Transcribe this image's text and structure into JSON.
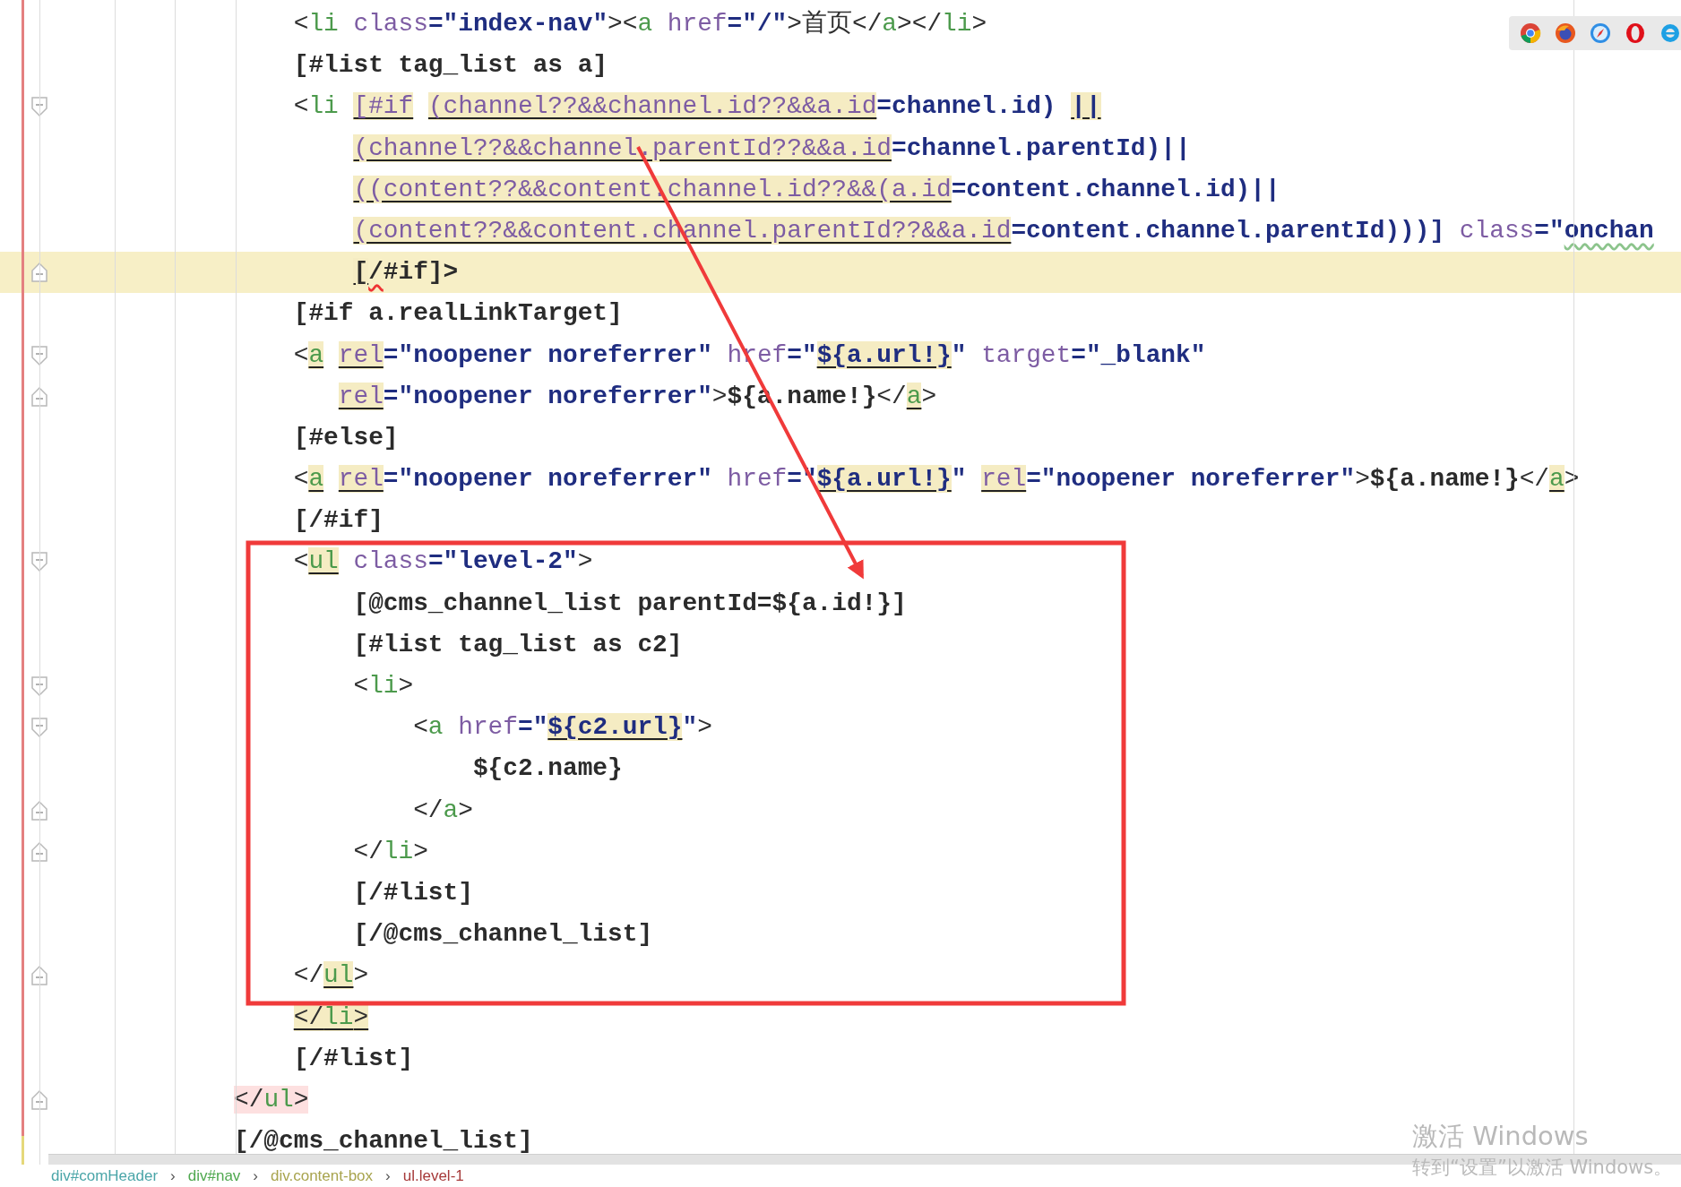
{
  "editor": {
    "lines": [
      {
        "fold_start": false,
        "fold_end": false,
        "current": false,
        "tokens": [
          {
            "kind": "punct",
            "text": "    <"
          },
          {
            "kind": "tag",
            "text": "li "
          },
          {
            "kind": "attr",
            "text": "class"
          },
          {
            "kind": "op",
            "text": "=\"index-nav\""
          },
          {
            "kind": "punct",
            "text": "><"
          },
          {
            "kind": "tag",
            "text": "a "
          },
          {
            "kind": "attr",
            "text": "href"
          },
          {
            "kind": "op",
            "text": "=\"/\""
          },
          {
            "kind": "punct",
            "text": ">"
          },
          {
            "kind": "plain",
            "text": "首页"
          },
          {
            "kind": "punct",
            "text": "</"
          },
          {
            "kind": "tag",
            "text": "a"
          },
          {
            "kind": "punct",
            "text": "></"
          },
          {
            "kind": "tag",
            "text": "li"
          },
          {
            "kind": "punct",
            "text": ">"
          }
        ]
      },
      {
        "fold_start": false,
        "fold_end": false,
        "current": false,
        "tokens": [
          {
            "kind": "directive",
            "text": "    [#list tag_list as a]"
          }
        ]
      },
      {
        "fold_start": true,
        "fold_end": false,
        "current": false,
        "tokens": [
          {
            "kind": "punct",
            "text": "    <"
          },
          {
            "kind": "tag",
            "text": "li "
          },
          {
            "kind": "expr_match",
            "text": "[#if "
          },
          {
            "kind": "expr_match",
            "text": "(channel??&&channel.id??&&a.id"
          },
          {
            "kind": "op",
            "text": "=channel.id) "
          },
          {
            "kind": "op_match",
            "text": "||"
          }
        ]
      },
      {
        "fold_start": false,
        "fold_end": false,
        "current": false,
        "tokens": [
          {
            "kind": "expr_match",
            "text": "        (channel??&&channel.parentId??&&a.id"
          },
          {
            "kind": "op",
            "text": "=channel.parentId)||"
          }
        ]
      },
      {
        "fold_start": false,
        "fold_end": false,
        "current": false,
        "tokens": [
          {
            "kind": "expr_match",
            "text": "        ((content??&&content.channel.id??&&(a.id"
          },
          {
            "kind": "op",
            "text": "=content.channel.id)||"
          }
        ]
      },
      {
        "fold_start": false,
        "fold_end": false,
        "current": false,
        "tokens": [
          {
            "kind": "expr_match",
            "text": "        (content??&&content.channel.parentId??&&a.id"
          },
          {
            "kind": "op",
            "text": "=content.channel.parentId)))] "
          },
          {
            "kind": "attr",
            "text": "class"
          },
          {
            "kind": "op",
            "text": "=\""
          },
          {
            "kind": "op_wave",
            "text": "onchan"
          }
        ]
      },
      {
        "fold_start": false,
        "fold_end": true,
        "current": true,
        "tokens": [
          {
            "kind": "directive_match",
            "text": "        ["
          },
          {
            "kind": "directive_error",
            "text": "/"
          },
          {
            "kind": "directive",
            "text": "#if]>"
          }
        ]
      },
      {
        "fold_start": false,
        "fold_end": false,
        "current": false,
        "tokens": [
          {
            "kind": "directive",
            "text": "    [#if a.realLinkTarget]"
          }
        ]
      },
      {
        "fold_start": true,
        "fold_end": false,
        "current": false,
        "tokens": [
          {
            "kind": "punct",
            "text": "    <"
          },
          {
            "kind": "tag_match",
            "text": "a "
          },
          {
            "kind": "attr_match",
            "text": "rel"
          },
          {
            "kind": "op",
            "text": "=\"noopener noreferrer\" "
          },
          {
            "kind": "attr",
            "text": "href"
          },
          {
            "kind": "op",
            "text": "=\""
          },
          {
            "kind": "op_match",
            "text": "${a.url!}"
          },
          {
            "kind": "op",
            "text": "\" "
          },
          {
            "kind": "attr",
            "text": "target"
          },
          {
            "kind": "op",
            "text": "=\"_blank\""
          }
        ]
      },
      {
        "fold_start": false,
        "fold_end": true,
        "current": false,
        "tokens": [
          {
            "kind": "attr_match",
            "text": "       rel"
          },
          {
            "kind": "op",
            "text": "=\"noopener noreferrer\""
          },
          {
            "kind": "punct",
            "text": ">"
          },
          {
            "kind": "directive",
            "text": "${a.name!}"
          },
          {
            "kind": "punct",
            "text": "</"
          },
          {
            "kind": "tag_match",
            "text": "a"
          },
          {
            "kind": "punct",
            "text": ">"
          }
        ]
      },
      {
        "fold_start": false,
        "fold_end": false,
        "current": false,
        "tokens": [
          {
            "kind": "directive",
            "text": "    [#else]"
          }
        ]
      },
      {
        "fold_start": false,
        "fold_end": false,
        "current": false,
        "tokens": [
          {
            "kind": "punct",
            "text": "    <"
          },
          {
            "kind": "tag_match",
            "text": "a "
          },
          {
            "kind": "attr_match",
            "text": "rel"
          },
          {
            "kind": "op",
            "text": "=\"noopener noreferrer\" "
          },
          {
            "kind": "attr",
            "text": "href"
          },
          {
            "kind": "op",
            "text": "=\""
          },
          {
            "kind": "op_match",
            "text": "${a.url!}"
          },
          {
            "kind": "op",
            "text": "\" "
          },
          {
            "kind": "attr_match",
            "text": "rel"
          },
          {
            "kind": "op",
            "text": "=\"noopener noreferrer\""
          },
          {
            "kind": "punct",
            "text": ">"
          },
          {
            "kind": "directive",
            "text": "${a.name!}"
          },
          {
            "kind": "punct",
            "text": "</"
          },
          {
            "kind": "tag_match",
            "text": "a"
          },
          {
            "kind": "punct",
            "text": ">"
          }
        ]
      },
      {
        "fold_start": false,
        "fold_end": false,
        "current": false,
        "tokens": [
          {
            "kind": "directive",
            "text": "    [/#if]"
          }
        ]
      },
      {
        "fold_start": true,
        "fold_end": false,
        "current": false,
        "tokens": [
          {
            "kind": "punct",
            "text": "    <"
          },
          {
            "kind": "tag_match",
            "text": "ul "
          },
          {
            "kind": "attr",
            "text": "class"
          },
          {
            "kind": "op",
            "text": "=\"level-2\""
          },
          {
            "kind": "punct",
            "text": ">"
          }
        ]
      },
      {
        "fold_start": false,
        "fold_end": false,
        "current": false,
        "tokens": [
          {
            "kind": "directive",
            "text": "        [@cms_channel_list parentId=${a.id!}]"
          }
        ]
      },
      {
        "fold_start": false,
        "fold_end": false,
        "current": false,
        "tokens": [
          {
            "kind": "directive",
            "text": "        [#list tag_list as c2]"
          }
        ]
      },
      {
        "fold_start": true,
        "fold_end": false,
        "current": false,
        "tokens": [
          {
            "kind": "punct",
            "text": "        <"
          },
          {
            "kind": "tag",
            "text": "li"
          },
          {
            "kind": "punct",
            "text": ">"
          }
        ]
      },
      {
        "fold_start": true,
        "fold_end": false,
        "current": false,
        "tokens": [
          {
            "kind": "punct",
            "text": "            <"
          },
          {
            "kind": "tag",
            "text": "a "
          },
          {
            "kind": "attr",
            "text": "href"
          },
          {
            "kind": "op",
            "text": "=\""
          },
          {
            "kind": "op_match",
            "text": "${c2.url}"
          },
          {
            "kind": "op",
            "text": "\""
          },
          {
            "kind": "punct",
            "text": ">"
          }
        ]
      },
      {
        "fold_start": false,
        "fold_end": false,
        "current": false,
        "tokens": [
          {
            "kind": "directive",
            "text": "                ${c2.name}"
          }
        ]
      },
      {
        "fold_start": false,
        "fold_end": true,
        "current": false,
        "tokens": [
          {
            "kind": "punct",
            "text": "            </"
          },
          {
            "kind": "tag",
            "text": "a"
          },
          {
            "kind": "punct",
            "text": ">"
          }
        ]
      },
      {
        "fold_start": false,
        "fold_end": true,
        "current": false,
        "tokens": [
          {
            "kind": "punct",
            "text": "        </"
          },
          {
            "kind": "tag",
            "text": "li"
          },
          {
            "kind": "punct",
            "text": ">"
          }
        ]
      },
      {
        "fold_start": false,
        "fold_end": false,
        "current": false,
        "tokens": [
          {
            "kind": "directive",
            "text": "        [/#list]"
          }
        ]
      },
      {
        "fold_start": false,
        "fold_end": false,
        "current": false,
        "tokens": [
          {
            "kind": "directive",
            "text": "        [/@cms_channel_list]"
          }
        ]
      },
      {
        "fold_start": false,
        "fold_end": true,
        "current": false,
        "tokens": [
          {
            "kind": "punct",
            "text": "    </"
          },
          {
            "kind": "tag_match",
            "text": "ul"
          },
          {
            "kind": "punct",
            "text": ">"
          }
        ]
      },
      {
        "fold_start": false,
        "fold_end": false,
        "current": false,
        "tokens": [
          {
            "kind": "punct_match",
            "text": "    </"
          },
          {
            "kind": "tag_match",
            "text": "li"
          },
          {
            "kind": "punct_match",
            "text": ">"
          }
        ]
      },
      {
        "fold_start": false,
        "fold_end": false,
        "current": false,
        "tokens": [
          {
            "kind": "directive",
            "text": "    [/#list]"
          }
        ]
      },
      {
        "fold_start": false,
        "fold_end": true,
        "current": false,
        "tokens": [
          {
            "kind": "punct_pink",
            "text": "</"
          },
          {
            "kind": "tag_pink",
            "text": "ul"
          },
          {
            "kind": "punct_pink",
            "text": ">"
          }
        ]
      },
      {
        "fold_start": false,
        "fold_end": false,
        "current": false,
        "tokens": [
          {
            "kind": "directive",
            "text": "[/@cms_channel_list]"
          }
        ]
      }
    ]
  },
  "annotation": {
    "frame": true,
    "arrow": true
  },
  "breadcrumb": {
    "separator": "›",
    "items": [
      {
        "label": "div#comHeader",
        "color": "#4aa5a8"
      },
      {
        "label": "div#nav",
        "color": "#4fa84f"
      },
      {
        "label": "div.content-box",
        "color": "#a8a44e"
      },
      {
        "label": "ul.level-1",
        "color": "#a63a3a"
      }
    ]
  },
  "activation_notice": {
    "title": "激活 Windows",
    "message": "转到“设置”以激活 Windows。"
  }
}
